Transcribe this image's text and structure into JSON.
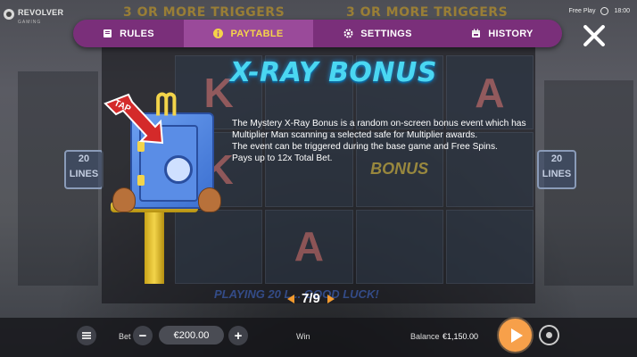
{
  "brand": {
    "name": "REVOLVER",
    "sub": "GAMING"
  },
  "status": {
    "mode": "Free Play",
    "time": "18:00"
  },
  "background": {
    "banner_left": "3 OR MORE TRIGGERS",
    "banner_right": "3 OR MORE TRIGGERS",
    "lines_left": "20 LINES",
    "lines_right": "20 LINES",
    "reel_letter_1": "K",
    "reel_letter_2": "A",
    "reel_letter_3": "K",
    "reel_letter_4": "A",
    "bonus_symbol": "BONUS",
    "footer_banner": "PLAYING 20 L... GOOD LUCK!"
  },
  "nav": {
    "tabs": [
      {
        "label": "RULES",
        "icon": "book-icon",
        "active": false
      },
      {
        "label": "PAYTABLE",
        "icon": "info-icon",
        "active": true
      },
      {
        "label": "SETTINGS",
        "icon": "gear-icon",
        "active": false
      },
      {
        "label": "HISTORY",
        "icon": "calendar-icon",
        "active": false
      }
    ]
  },
  "page": {
    "title": "X-RAY BONUS",
    "tap_label": "TAP",
    "description": [
      "The Mystery X-Ray Bonus is a random on-screen bonus event which has Multiplier Man scanning a selected safe for Multiplier awards.",
      "The event can be triggered during the base game and Free Spins.",
      "Pays up to 12x Total Bet."
    ],
    "pager": "7/9"
  },
  "bottom": {
    "bet_label": "Bet",
    "bet_value": "€200.00",
    "win_label": "Win",
    "balance_label": "Balance",
    "balance_value": "€1,150.00"
  },
  "colors": {
    "nav_bg": "#7a2f7a",
    "nav_active_text": "#f5d34a",
    "title": "#4ad7f2",
    "spin_button": "#f7a04a"
  }
}
